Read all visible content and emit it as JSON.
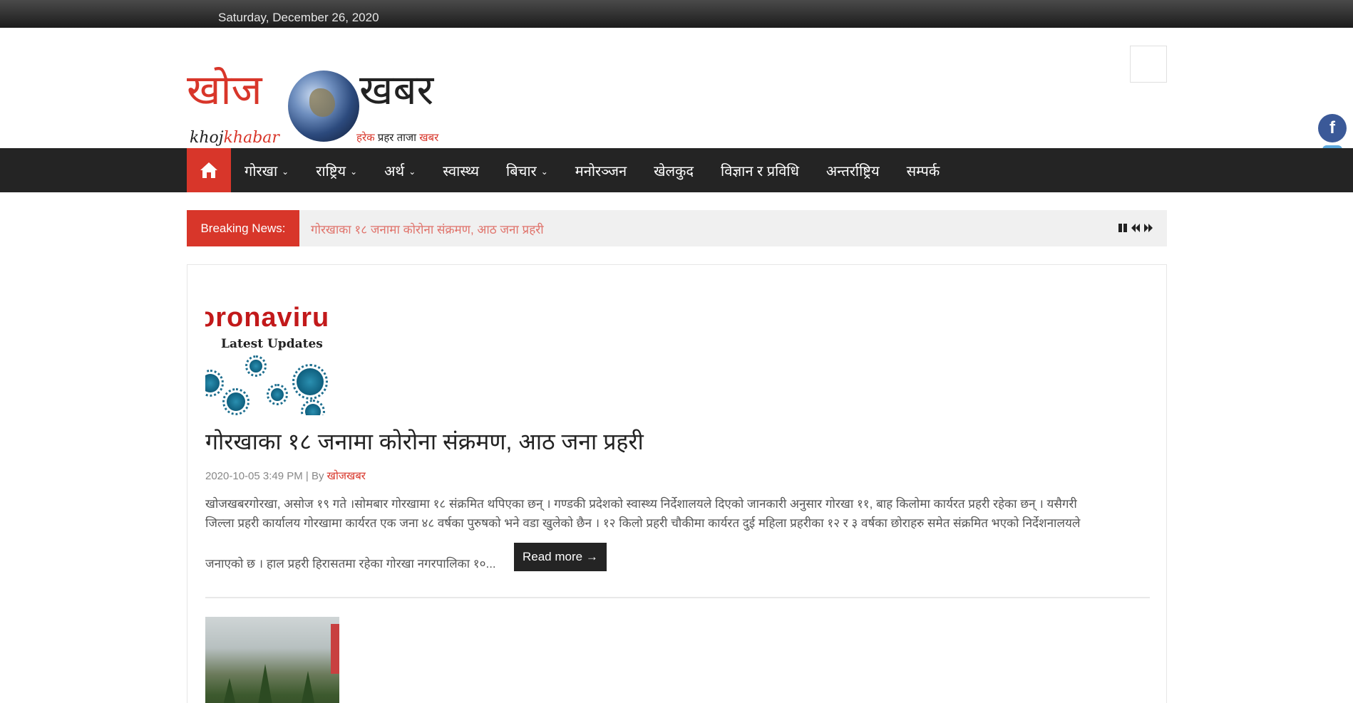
{
  "topbar": {
    "date": "Saturday, December 26, 2020"
  },
  "logo": {
    "word1": "खोज",
    "word2": "खबर",
    "latin_part1": "khoj",
    "latin_part2": "khabar",
    "tagline_part1": "हरेक",
    "tagline_part2": "प्रहर ताजा",
    "tagline_part3": "खबर"
  },
  "nav": {
    "items": [
      {
        "label": "गोरखा",
        "has_dropdown": true
      },
      {
        "label": "राष्ट्रिय",
        "has_dropdown": true
      },
      {
        "label": "अर्थ",
        "has_dropdown": true
      },
      {
        "label": "स्वास्थ्य",
        "has_dropdown": false
      },
      {
        "label": "बिचार",
        "has_dropdown": true
      },
      {
        "label": "मनोरञ्जन",
        "has_dropdown": false
      },
      {
        "label": "खेलकुद",
        "has_dropdown": false
      },
      {
        "label": "विज्ञान र प्रविधि",
        "has_dropdown": false
      },
      {
        "label": "अन्तर्राष्ट्रिय",
        "has_dropdown": false
      },
      {
        "label": "सम्पर्क",
        "has_dropdown": false
      }
    ],
    "chevron": "⌄"
  },
  "breaking": {
    "label": "Breaking News:",
    "headline": "गोरखाका १८ जनामा कोरोना संक्रमण, आठ जना प्रहरी"
  },
  "post": {
    "thumb_text_big": "oronaviru",
    "thumb_text_small": "Latest Updates",
    "title": "गोरखाका १८ जनामा कोरोना संक्रमण, आठ जना प्रहरी",
    "meta_date": "2020-10-05 3:49 PM",
    "meta_sep": " | By ",
    "author": "खोजखबर",
    "excerpt_line1": "खोजखबरगोरखा, असोज १९ गते ।सोमबार गोरखामा १८ संक्रमित थपिएका छन् । गण्डकी प्रदेशको स्वास्थ्य निर्देशालयले दिएको जानकारी अनुसार गोरखा ११, बाह किलोमा कार्यरत प्रहरी रहेका छन् । यसैगरी",
    "excerpt_line2": "जिल्ला प्रहरी कार्यालय गोरखामा कार्यरत एक जना ४८ वर्षका पुरुषको भने वडा खुलेको छैन । १२ किलो प्रहरी चौकीमा कार्यरत दुई महिला प्रहरीका १२ र ३ वर्षका छोराहरु समेत संक्रमित भएको निर्देशनालयले",
    "excerpt_line3": "जनाएको छ । हाल प्रहरी हिरासतमा रहेका गोरखा नगरपालिका १०...",
    "read_more": "Read more →"
  },
  "social": {
    "facebook_glyph": "f"
  },
  "icons": {
    "home": "home-icon",
    "pause": "pause-icon",
    "prev": "prev-icon",
    "next": "next-icon",
    "facebook": "facebook-icon"
  },
  "colors": {
    "accent": "#d8362a",
    "nav_bg": "#242424",
    "facebook": "#3b5998"
  }
}
